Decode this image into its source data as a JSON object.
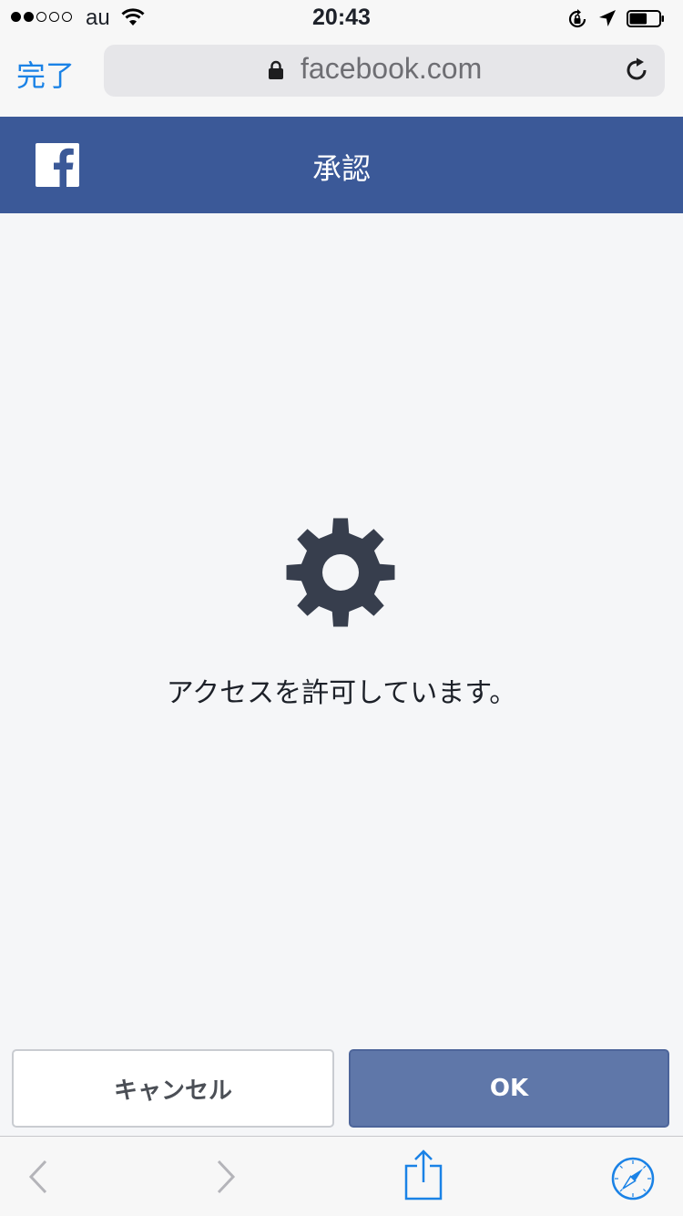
{
  "status_bar": {
    "carrier": "au",
    "time": "20:43",
    "signal_bars": 2,
    "signal_total": 5,
    "battery_level": 0.6,
    "icons": [
      "wifi-icon",
      "rotation-lock-icon",
      "location-arrow-icon",
      "battery-icon"
    ]
  },
  "browser": {
    "done_label": "完了",
    "url": "facebook.com",
    "icons": [
      "padlock-icon",
      "reload-icon"
    ]
  },
  "header": {
    "title": "承認",
    "logo": "facebook-logo"
  },
  "content": {
    "message": "アクセスを許可しています。",
    "icon": "gear-icon"
  },
  "buttons": {
    "cancel_label": "キャンセル",
    "ok_label": "OK"
  },
  "toolbar": {
    "icons": [
      "back-icon",
      "forward-icon",
      "share-icon",
      "safari-compass-icon"
    ]
  },
  "colors": {
    "facebook_blue": "#3b5998",
    "ok_button": "#5f77a9",
    "ios_blue": "#1a82e6",
    "gear": "#373e4d"
  }
}
